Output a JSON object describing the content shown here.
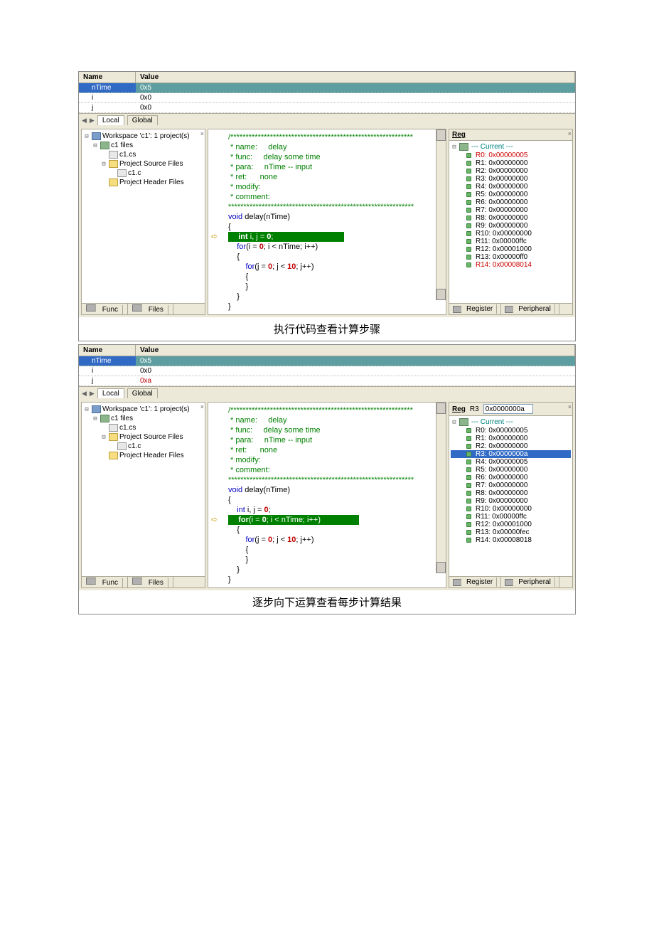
{
  "section1": {
    "vars": {
      "header": {
        "name": "Name",
        "value": "Value"
      },
      "rows": [
        {
          "name": "nTime",
          "value": "0x5",
          "selected": true
        },
        {
          "name": "i",
          "value": "0x0"
        },
        {
          "name": "j",
          "value": "0x0"
        }
      ],
      "tabs": {
        "local": "Local",
        "global": "Global"
      }
    },
    "tree": {
      "ws": "Workspace 'c1': 1 project(s)",
      "proj": "c1 files",
      "cs": "c1.cs",
      "src": "Project Source Files",
      "cfile": "c1.c",
      "hdr": "Project Header Files",
      "tabs": {
        "func": "Func",
        "files": "Files"
      }
    },
    "code": {
      "l1": "/************************************************************",
      "l2": " * name:     delay",
      "l3": " * func:     delay some time",
      "l4": " * para:     nTime -- input",
      "l5": " * ret:      none",
      "l6": " * modify:",
      "l7": " * comment:",
      "l8": "*************************************************************",
      "l9a": "void",
      "l9b": " delay(nTime)",
      "l10": "{",
      "l11a": "    int",
      "l11b": " i, j = ",
      "l11c": "0",
      "l11d": ";",
      "l12": "",
      "l13a": "    for",
      "l13b": "(i = ",
      "l13c": "0",
      "l13d": "; i < nTime; i++)",
      "l14": "    {",
      "l15a": "        for",
      "l15b": "(j = ",
      "l15c": "0",
      "l15d": "; j < ",
      "l15e": "10",
      "l15f": "; j++)",
      "l16": "        {",
      "l17": "        }",
      "l18": "    }",
      "l19": "}"
    },
    "reg": {
      "label": "Reg",
      "title": "--- Current ---",
      "rows": [
        {
          "t": "R0: 0x00000005",
          "c": "red"
        },
        {
          "t": "R1: 0x00000000"
        },
        {
          "t": "R2: 0x00000000"
        },
        {
          "t": "R3: 0x00000000"
        },
        {
          "t": "R4: 0x00000000"
        },
        {
          "t": "R5: 0x00000000"
        },
        {
          "t": "R6: 0x00000000"
        },
        {
          "t": "R7: 0x00000000"
        },
        {
          "t": "R8: 0x00000000"
        },
        {
          "t": "R9: 0x00000000"
        },
        {
          "t": "R10: 0x00000000"
        },
        {
          "t": "R11: 0x00000ffc"
        },
        {
          "t": "R12: 0x00001000"
        },
        {
          "t": "R13: 0x00000ff0"
        },
        {
          "t": "R14: 0x00008014",
          "c": "red"
        }
      ],
      "tabs": {
        "reg": "Register",
        "per": "Peripheral"
      }
    },
    "caption": "执行代码查看计算步骤"
  },
  "section2": {
    "vars": {
      "rows": [
        {
          "name": "nTime",
          "value": "0x5",
          "selected": true
        },
        {
          "name": "i",
          "value": "0x0"
        },
        {
          "name": "j",
          "value": "0xa",
          "red": true
        }
      ]
    },
    "reg": {
      "selname": "R3",
      "selval": "0x0000000a",
      "title": "--- Current ---",
      "rows": [
        {
          "t": "R0: 0x00000005"
        },
        {
          "t": "R1: 0x00000000"
        },
        {
          "t": "R2: 0x00000000"
        },
        {
          "t": "R3: 0x0000000a",
          "sel": true
        },
        {
          "t": "R4: 0x00000005"
        },
        {
          "t": "R5: 0x00000000"
        },
        {
          "t": "R6: 0x00000000"
        },
        {
          "t": "R7: 0x00000000"
        },
        {
          "t": "R8: 0x00000000"
        },
        {
          "t": "R9: 0x00000000"
        },
        {
          "t": "R10: 0x00000000"
        },
        {
          "t": "R11: 0x00000ffc"
        },
        {
          "t": "R12: 0x00001000"
        },
        {
          "t": "R13: 0x00000fec"
        },
        {
          "t": "R14: 0x00008018"
        }
      ]
    },
    "caption": "逐步向下运算查看每步计算结果"
  }
}
